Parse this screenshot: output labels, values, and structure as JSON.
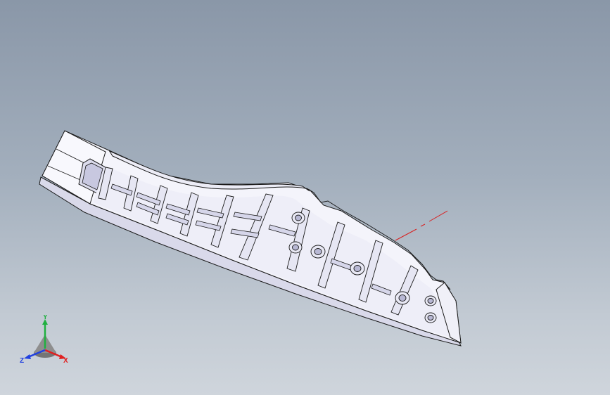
{
  "viewport": {
    "background_top": "#8a97a8",
    "background_bottom": "#cfd5dc"
  },
  "model": {
    "part_color": "#f4f4fb",
    "rib_color": "#e3e3f0",
    "shadow_color": "#cfcfe6",
    "edge_color": "#1a1a1a",
    "sketch_line_color": "#d82020"
  },
  "triad": {
    "x_label": "X",
    "y_label": "Y",
    "z_label": "Z",
    "x_color": "#e02020",
    "y_color": "#20b040",
    "z_color": "#2040e0"
  }
}
